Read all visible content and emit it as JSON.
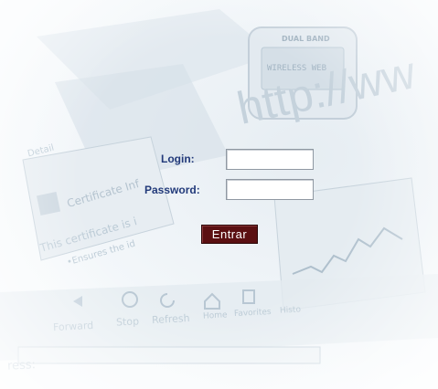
{
  "background": {
    "url_text": "http://ww",
    "phone_band_label": "DUAL BAND",
    "phone_screen_text": "WIRELESS WEB",
    "cert_tab_text": "Detail",
    "certificate_title": "Certificate Inf",
    "certificate_line1": "This certificate is i",
    "certificate_line2": "•Ensures the id",
    "toolbar": {
      "forward": "Forward",
      "stop": "Stop",
      "refresh": "Refresh",
      "home": "Home",
      "favorites": "Favorites",
      "history": "Histo"
    },
    "address_label": "ress:"
  },
  "form": {
    "login_label": "Login:",
    "password_label": "Password:",
    "login_value": "",
    "password_value": "",
    "submit_label": "Entrar"
  },
  "colors": {
    "label": "#223a7a",
    "button_bg": "#5b1012",
    "button_text": "#ffffff"
  }
}
